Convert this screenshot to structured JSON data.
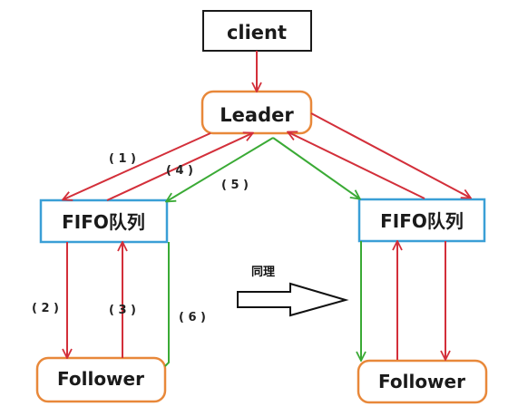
{
  "nodes": {
    "client": "client",
    "leader": "Leader",
    "fifo_left": "FIFO队列",
    "fifo_right": "FIFO队列",
    "follower_left": "Follower",
    "follower_right": "Follower"
  },
  "steps": {
    "s1": "( 1 )",
    "s2": "( 2 )",
    "s3": "( 3 )",
    "s4": "( 4 )",
    "s5": "( 5 )",
    "s6": "( 6 )"
  },
  "note": "同理",
  "colors": {
    "request_arrow": "#d32f3a",
    "commit_arrow": "#3aaa35",
    "leader_border": "#e8883a",
    "follower_border": "#e8883a",
    "fifo_border": "#3a9fd6",
    "client_border": "#1a1a1a"
  }
}
